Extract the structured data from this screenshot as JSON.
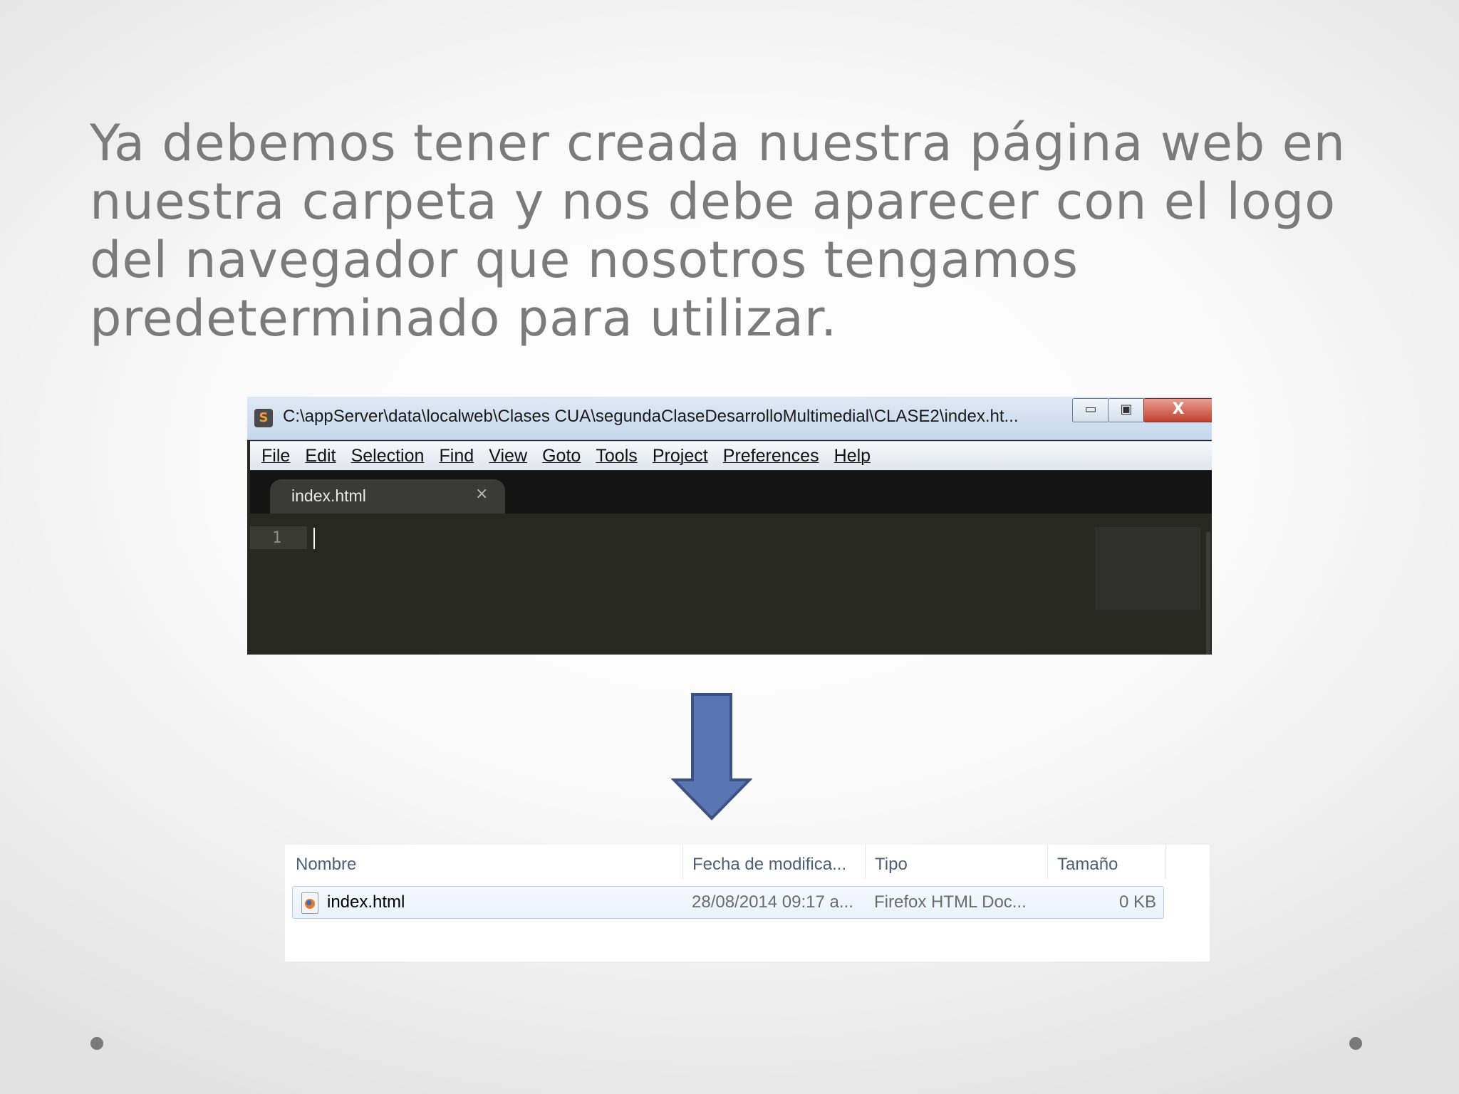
{
  "slide": {
    "title": "Ya debemos tener creada nuestra página web en nuestra carpeta y nos debe aparecer con el logo del navegador que nosotros tengamos predeterminado para utilizar."
  },
  "editor": {
    "window_title": "C:\\appServer\\data\\localweb\\Clases CUA\\segundaClaseDesarrolloMultimedial\\CLASE2\\index.ht...",
    "controls": {
      "minimize": "▭",
      "maximize": "▣",
      "close": "X"
    },
    "menu": [
      "File",
      "Edit",
      "Selection",
      "Find",
      "View",
      "Goto",
      "Tools",
      "Project",
      "Preferences",
      "Help"
    ],
    "tab": {
      "label": "index.html",
      "close": "×"
    },
    "line_number": "1"
  },
  "explorer": {
    "columns": {
      "name": "Nombre",
      "date": "Fecha de modifica...",
      "type": "Tipo",
      "size": "Tamaño"
    },
    "rows": [
      {
        "name": "index.html",
        "date": "28/08/2014 09:17 a...",
        "type": "Firefox HTML Doc...",
        "size": "0 KB",
        "icon": "firefox-html-icon"
      }
    ]
  },
  "colors": {
    "arrow_fill": "#5b75b3",
    "arrow_stroke": "#3c5284",
    "title_text": "#7b7b7b"
  }
}
